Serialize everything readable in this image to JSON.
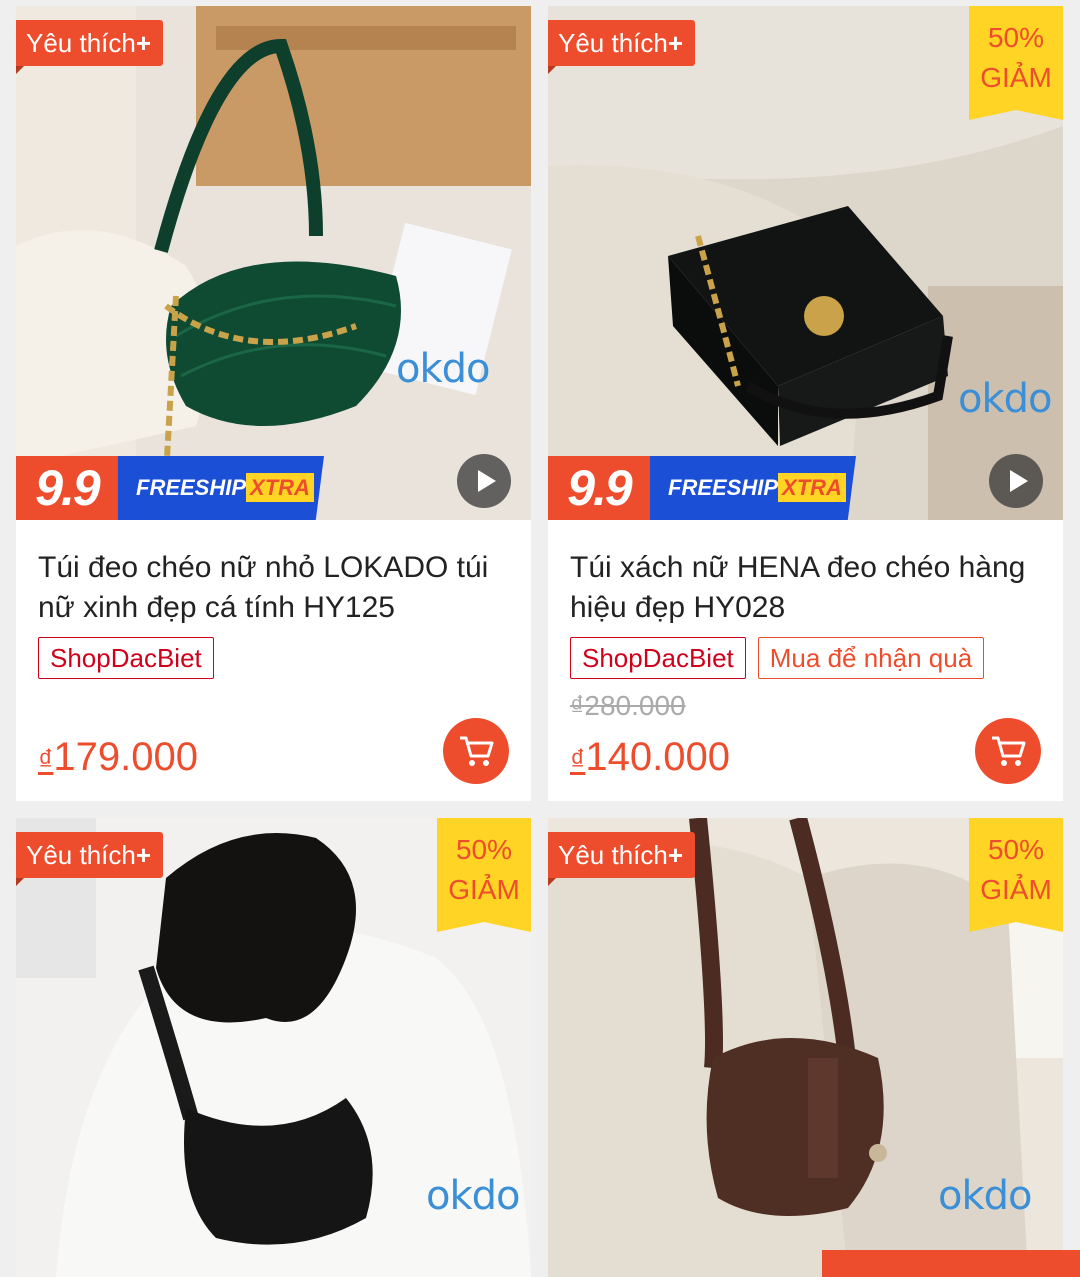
{
  "theme": {
    "accent": "#ee4d2d",
    "tag_red": "#d0011b",
    "discount_bg": "#ffd424",
    "freeship_bg": "#1a4fd6"
  },
  "products": [
    {
      "favorite_badge": "Yêu thích",
      "favorite_plus": "+",
      "promo_nine": "9.9",
      "freeship_text": "FREESHIP",
      "freeship_xtra": "XTRA",
      "watermark": "okdo",
      "title": "Túi đeo chéo nữ nhỏ LOKADO túi nữ xinh đẹp cá tính HY125",
      "tags": [
        "ShopDacBiet"
      ],
      "currency": "₫",
      "price": "179.000",
      "icons": [
        "play-icon",
        "cart-icon"
      ]
    },
    {
      "favorite_badge": "Yêu thích",
      "favorite_plus": "+",
      "discount_pct": "50%",
      "discount_word": "GIẢM",
      "promo_nine": "9.9",
      "freeship_text": "FREESHIP",
      "freeship_xtra": "XTRA",
      "watermark": "okdo",
      "title": "Túi xách nữ HENA đeo chéo hàng hiệu đẹp HY028",
      "tags": [
        "ShopDacBiet",
        "Mua để nhận quà"
      ],
      "old_price": "₫280.000",
      "currency": "₫",
      "price": "140.000",
      "icons": [
        "play-icon",
        "cart-icon"
      ]
    },
    {
      "favorite_badge": "Yêu thích",
      "favorite_plus": "+",
      "discount_pct": "50%",
      "discount_word": "GIẢM",
      "watermark": "okdo"
    },
    {
      "favorite_badge": "Yêu thích",
      "favorite_plus": "+",
      "discount_pct": "50%",
      "discount_word": "GIẢM",
      "watermark": "okdo"
    }
  ]
}
